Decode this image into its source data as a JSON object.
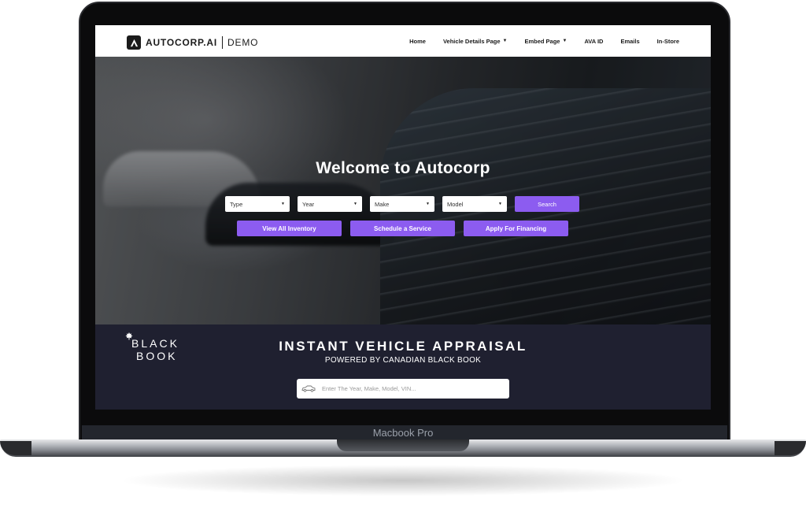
{
  "device": {
    "label": "Macbook Pro"
  },
  "nav": {
    "brand": "AUTOCORP.AI",
    "brand_tm": "°",
    "demo": "DEMO",
    "items": [
      {
        "label": "Home",
        "has_dropdown": false
      },
      {
        "label": "Vehicle Details Page",
        "has_dropdown": true
      },
      {
        "label": "Embed Page",
        "has_dropdown": true
      },
      {
        "label": "AVA ID",
        "has_dropdown": false
      },
      {
        "label": "Emails",
        "has_dropdown": false
      },
      {
        "label": "In-Store",
        "has_dropdown": false
      }
    ]
  },
  "hero": {
    "title": "Welcome to Autocorp",
    "filters": [
      {
        "value": "Type"
      },
      {
        "value": "Year"
      },
      {
        "value": "Make"
      },
      {
        "value": "Model"
      }
    ],
    "search_label": "Search",
    "actions": [
      {
        "label": "View All Inventory"
      },
      {
        "label": "Schedule a Service"
      },
      {
        "label": "Apply For Financing"
      }
    ]
  },
  "appraisal": {
    "logo_line1": "BLACK",
    "logo_line2": "BOOK",
    "title": "INSTANT VEHICLE APPRAISAL",
    "subtitle": "POWERED BY CANADIAN BLACK BOOK",
    "input_placeholder": "Enter The Year, Make, Model, VIN..."
  },
  "colors": {
    "accent": "#8c5cf0",
    "dark_panel": "#1f2030",
    "nav_bg": "#ffffff"
  },
  "icons": {
    "logo": "autocorp-logo-icon",
    "leaf": "maple-leaf-icon",
    "car": "car-icon",
    "dropdown": "chevron-down-icon"
  }
}
